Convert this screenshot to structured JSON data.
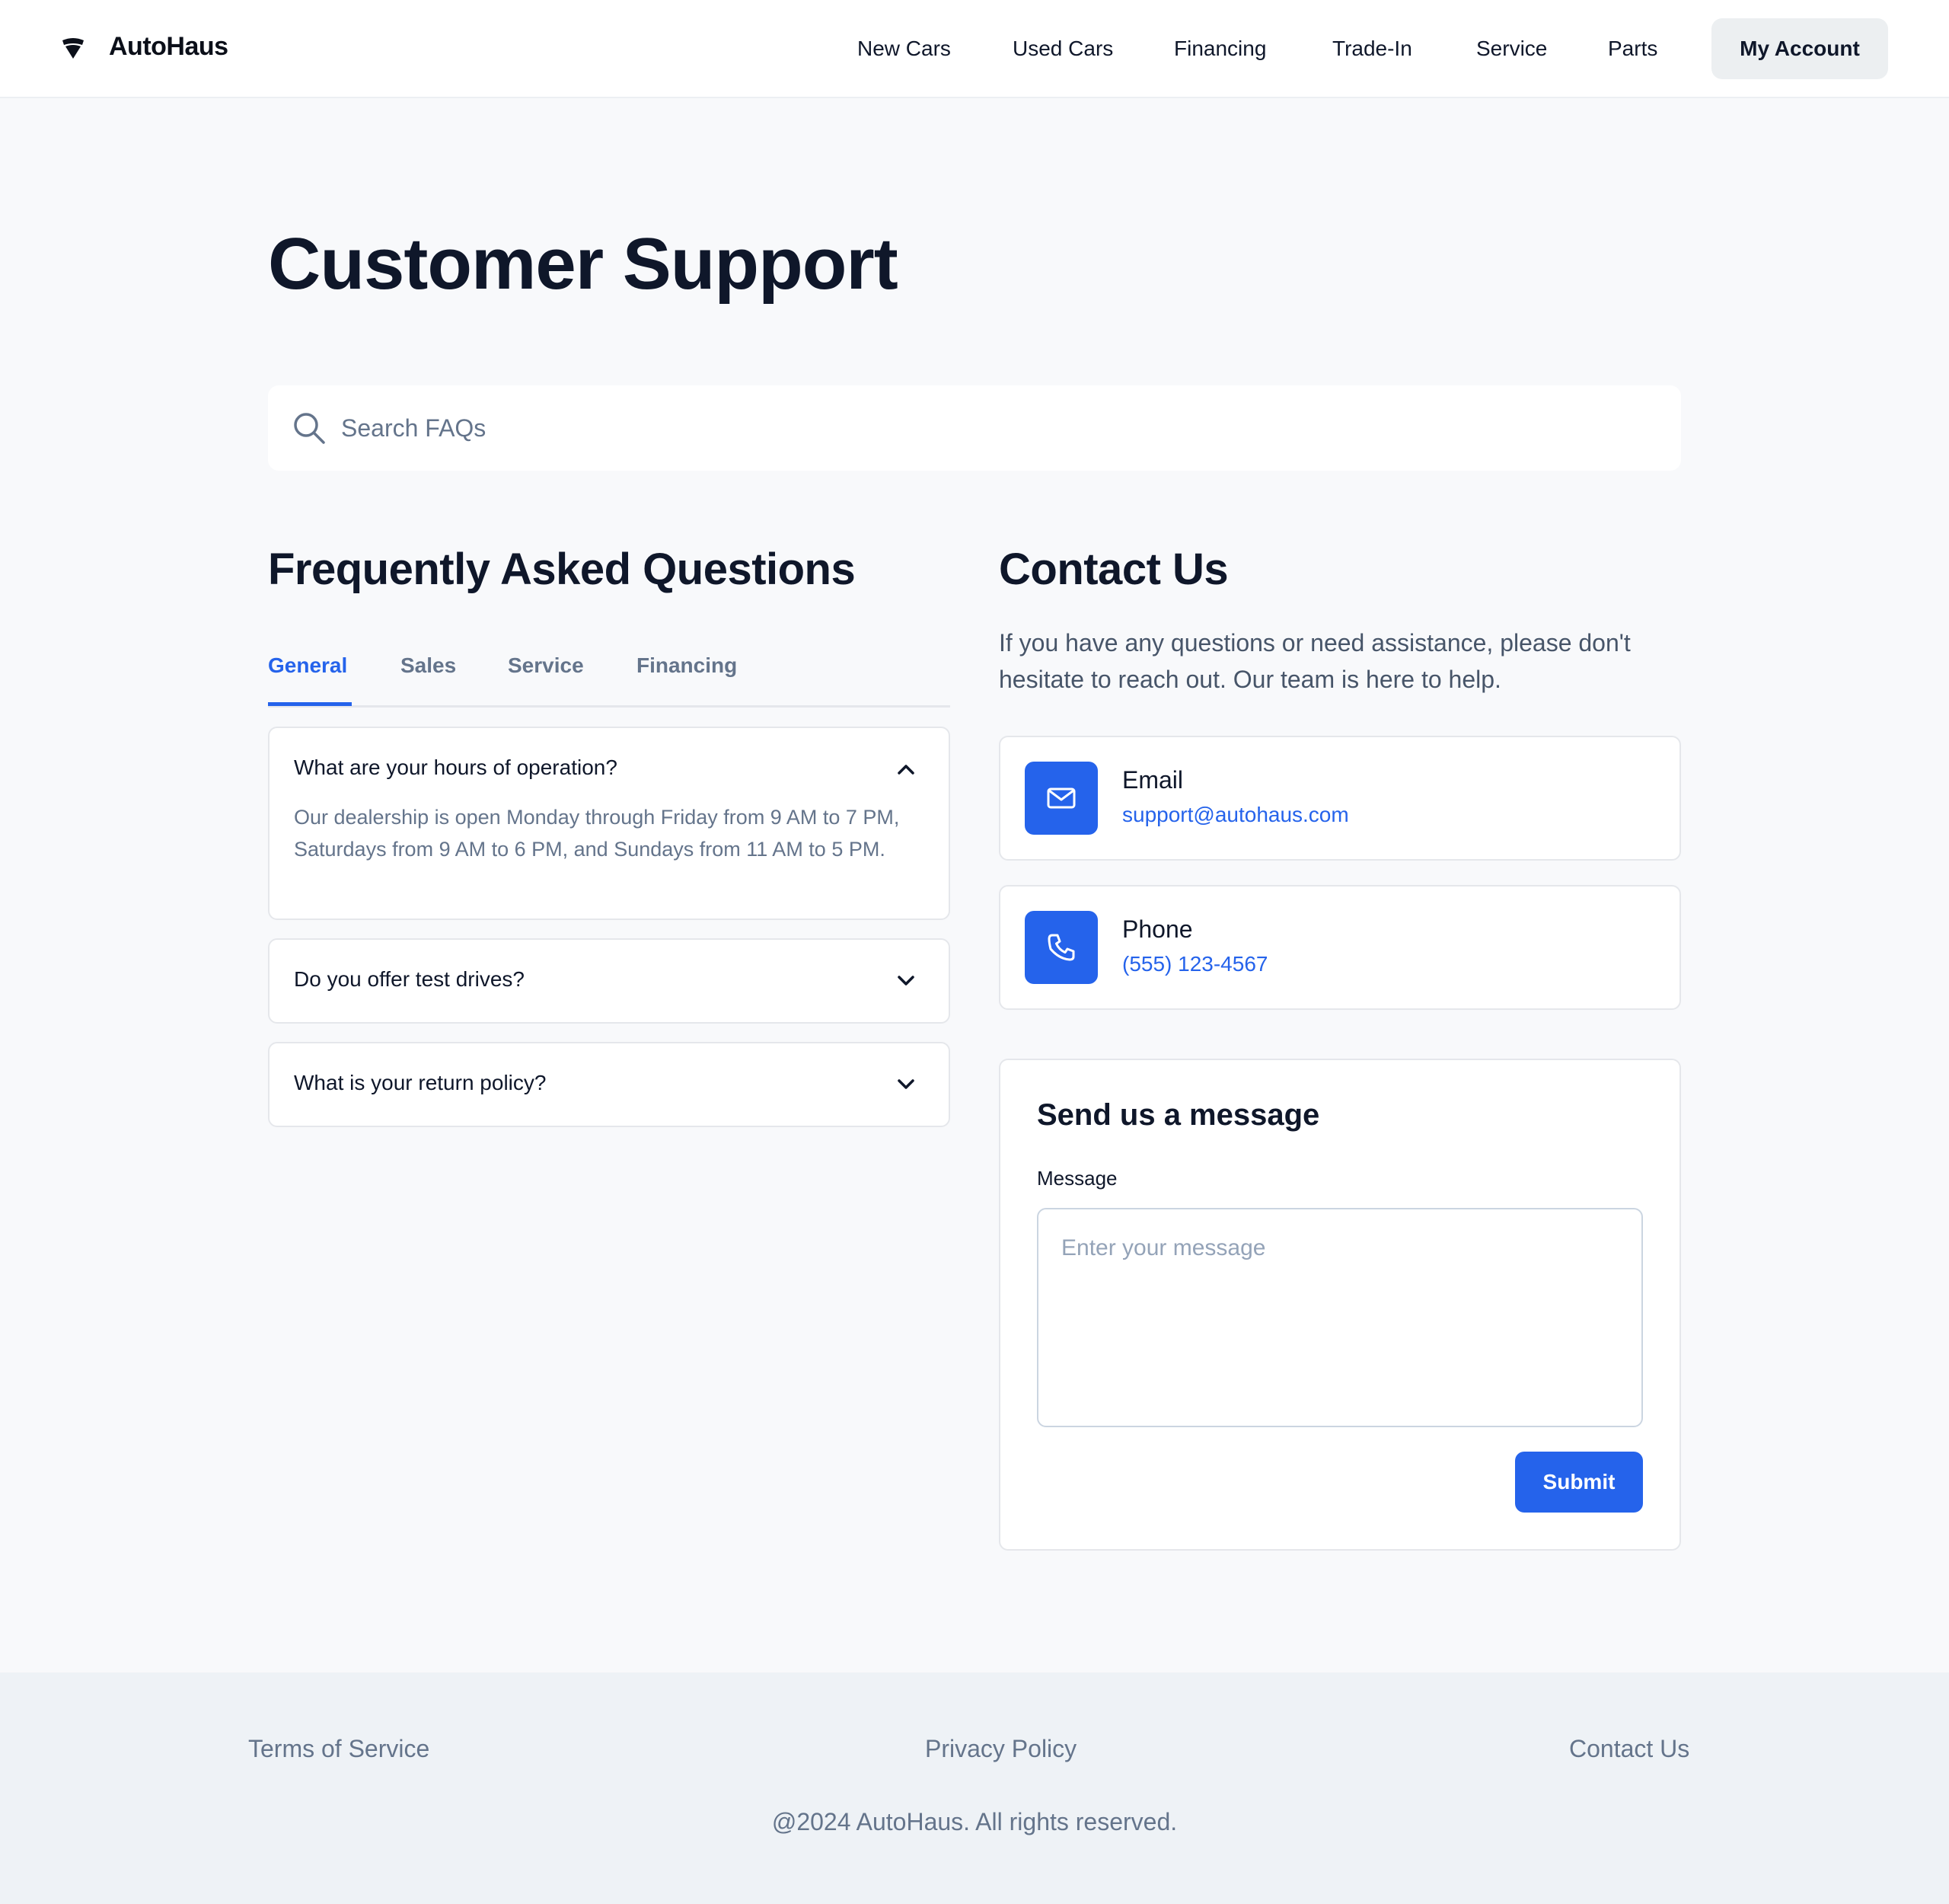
{
  "header": {
    "logo_text": "AutoHaus",
    "nav": [
      "New Cars",
      "Used Cars",
      "Financing",
      "Trade-In",
      "Service",
      "Parts"
    ],
    "account_label": "My Account"
  },
  "page": {
    "title": "Customer Support"
  },
  "search": {
    "placeholder": "Search FAQs"
  },
  "faq": {
    "heading": "Frequently Asked Questions",
    "tabs": [
      "General",
      "Sales",
      "Service",
      "Financing"
    ],
    "active_tab": "General",
    "items": [
      {
        "question": "What are your hours of operation?",
        "answer": "Our dealership is open Monday through Friday from 9 AM to 7 PM, Saturdays from 9 AM to 6 PM, and Sundays from 11 AM to 5 PM.",
        "expanded": true
      },
      {
        "question": "Do you offer test drives?",
        "expanded": false
      },
      {
        "question": "What is your return policy?",
        "expanded": false
      }
    ]
  },
  "contact": {
    "heading": "Contact Us",
    "intro": "If you have any questions or need assistance, please don't hesitate to reach out. Our team is here to help.",
    "email": {
      "label": "Email",
      "value": "support@autohaus.com"
    },
    "phone": {
      "label": "Phone",
      "value": "(555) 123-4567"
    }
  },
  "message_form": {
    "title": "Send us a message",
    "field_label": "Message",
    "placeholder": "Enter your message",
    "submit_label": "Submit"
  },
  "footer": {
    "links": [
      "Terms of Service",
      "Privacy Policy",
      "Contact Us"
    ],
    "copyright": "@2024 AutoHaus. All rights reserved."
  },
  "colors": {
    "accent": "#2563eb",
    "background": "#f8f9fb",
    "footer_bg": "#eef2f6",
    "text_primary": "#0f172a",
    "text_muted": "#64748b"
  },
  "icons": {
    "logo": "shield-logo-icon",
    "search": "search-icon",
    "chevron_up": "chevron-up-icon",
    "chevron_down": "chevron-down-icon",
    "email": "mail-icon",
    "phone": "phone-icon"
  }
}
